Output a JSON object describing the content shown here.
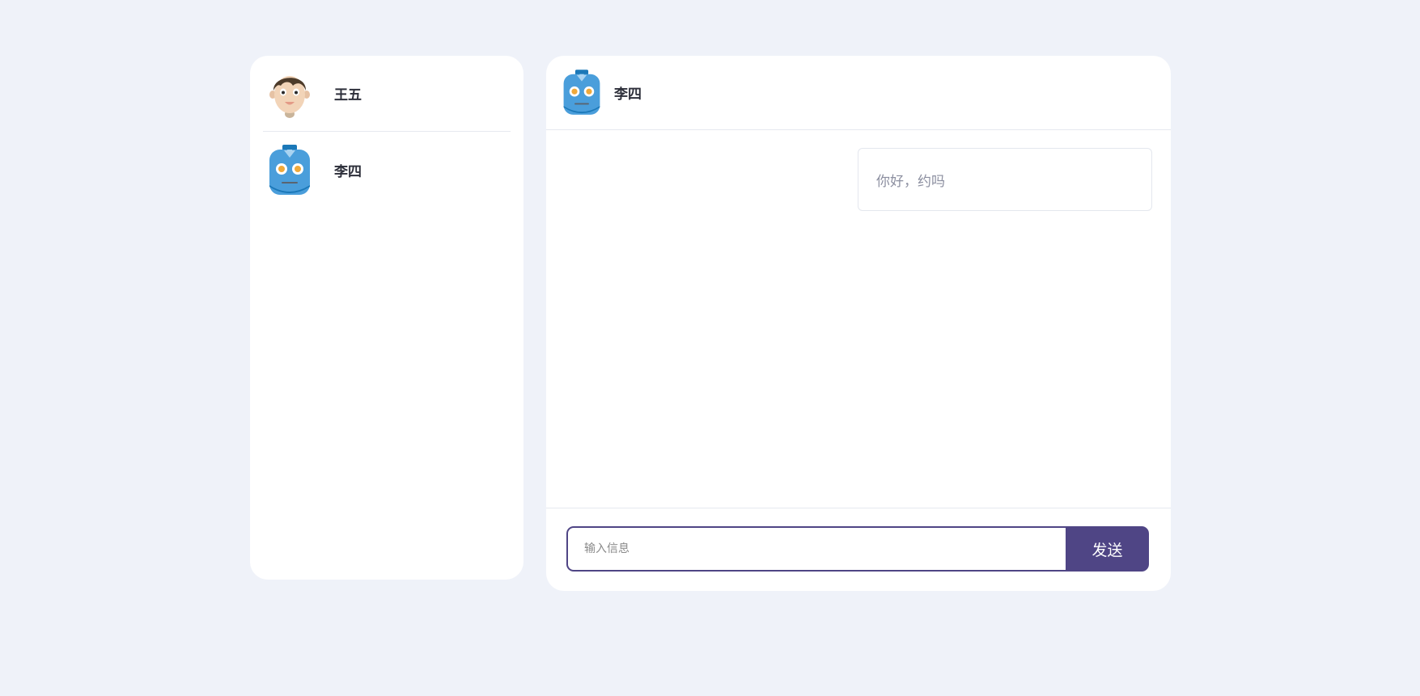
{
  "contacts": [
    {
      "name": "王五",
      "avatar": "boy-avatar-icon"
    },
    {
      "name": "李四",
      "avatar": "robot-avatar-icon"
    }
  ],
  "chat": {
    "header": {
      "name": "李四",
      "avatar": "robot-avatar-icon"
    },
    "messages": [
      {
        "text": "你好，约吗"
      }
    ]
  },
  "composer": {
    "placeholder": "输入信息",
    "value": "",
    "send_label": "发送"
  },
  "colors": {
    "background": "#eff2f9",
    "accent": "#4f4585",
    "robot_blue": "#4a9edb",
    "panel": "#ffffff"
  }
}
